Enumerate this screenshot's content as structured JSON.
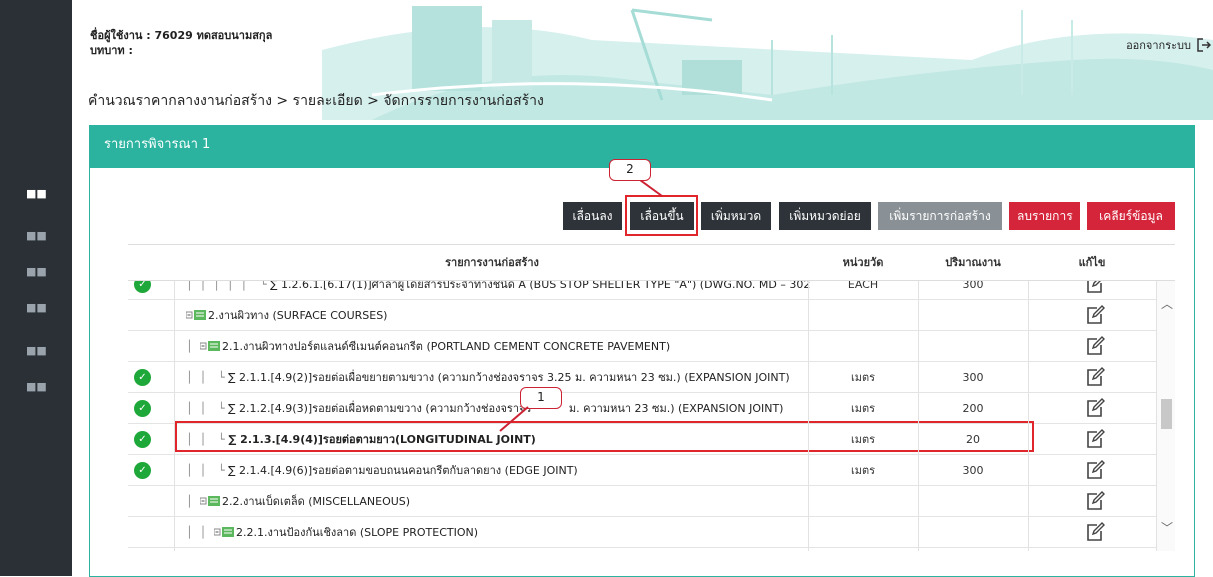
{
  "user": {
    "label": "ชื่อผู้ใช้งาน : 76029 ทดสอบนามสกุล",
    "role": "บทบาท :"
  },
  "logout": {
    "label": "ออกจากระบบ"
  },
  "breadcrumb": "คำนวณราคากลางงานก่อสร้าง > รายละเอียด > จัดการรายการงานก่อสร้าง",
  "panel": {
    "title": "รายการพิจารณา 1"
  },
  "toolbar": {
    "move_down": "เลื่อนลง",
    "move_up": "เลื่อนขึ้น",
    "add_category": "เพิ่มหมวด",
    "add_subcategory": "เพิ่มหมวดย่อย",
    "add_item": "เพิ่มรายการก่อสร้าง",
    "delete_item": "ลบรายการ",
    "clear_data": "เคลียร์ข้อมูล"
  },
  "table": {
    "headers": {
      "item": "รายการงานก่อสร้าง",
      "unit": "หน่วยวัด",
      "qty": "ปริมาณงาน",
      "edit": "แก้ไข"
    },
    "rows": [
      {
        "name": "∑ 1.2.6.1.[6.17(1)]ศาลาผู้โดยสารประจำทางชนิด A (BUS STOP SHELTER TYPE \"A\") (DWG.NO. MD – 302",
        "unit": "EACH",
        "qty": "300",
        "checked": true,
        "kind": "item",
        "level": 5
      },
      {
        "name": "2.งานผิวทาง (SURFACE COURSES)",
        "unit": "",
        "qty": "",
        "checked": false,
        "kind": "folder",
        "level": 0
      },
      {
        "name": "2.1.งานผิวทางปอร์ตแลนด์ซีเมนต์คอนกรีต (PORTLAND CEMENT CONCRETE PAVEMENT)",
        "unit": "",
        "qty": "",
        "checked": false,
        "kind": "folder",
        "level": 1
      },
      {
        "name": "∑ 2.1.1.[4.9(2)]รอยต่อเผื่อขยายตามขวาง (ความกว้างช่องจราจร 3.25 ม. ความหนา 23 ซม.) (EXPANSION JOINT)",
        "unit": "เมตร",
        "qty": "300",
        "checked": true,
        "kind": "item",
        "level": 2
      },
      {
        "name": "∑ 2.1.2.[4.9(3)]รอยต่อเผื่อหดตามขวาง (ความกว้างช่องจราจร",
        "name_tail": "ม. ความหนา 23 ซม.) (EXPANSION JOINT)",
        "unit": "เมตร",
        "qty": "200",
        "checked": true,
        "kind": "item",
        "level": 2
      },
      {
        "name": "∑ 2.1.3.[4.9(4)]รอยต่อตามยาว(LONGITUDINAL JOINT)",
        "unit": "เมตร",
        "qty": "20",
        "checked": true,
        "kind": "item",
        "level": 2,
        "bold": true
      },
      {
        "name": "∑ 2.1.4.[4.9(6)]รอยต่อตามขอบถนนคอนกรีตกับลาดยาง (EDGE JOINT)",
        "unit": "เมตร",
        "qty": "300",
        "checked": true,
        "kind": "item",
        "level": 2
      },
      {
        "name": "2.2.งานเบ็ดเตล็ด (MISCELLANEOUS)",
        "unit": "",
        "qty": "",
        "checked": false,
        "kind": "folder",
        "level": 1
      },
      {
        "name": "2.2.1.งานป้องกันเชิงลาด (SLOPE PROTECTION)",
        "unit": "",
        "qty": "",
        "checked": false,
        "kind": "folder",
        "level": 2
      }
    ]
  },
  "callouts": {
    "one": "1",
    "two": "2"
  },
  "icons": {
    "sidebar": "grid-icon",
    "logout": "logout-icon",
    "edit": "edit-icon",
    "check": "check-circle-icon",
    "folder": "folder-tree-icon"
  },
  "colors": {
    "sidebar": "#2a3036",
    "teal": "#2bb3a0",
    "dark_button": "#2d3338",
    "red_button": "#d4253a",
    "grey_button": "#8a9196",
    "check": "#1fa83a",
    "highlight": "#e0262b"
  }
}
